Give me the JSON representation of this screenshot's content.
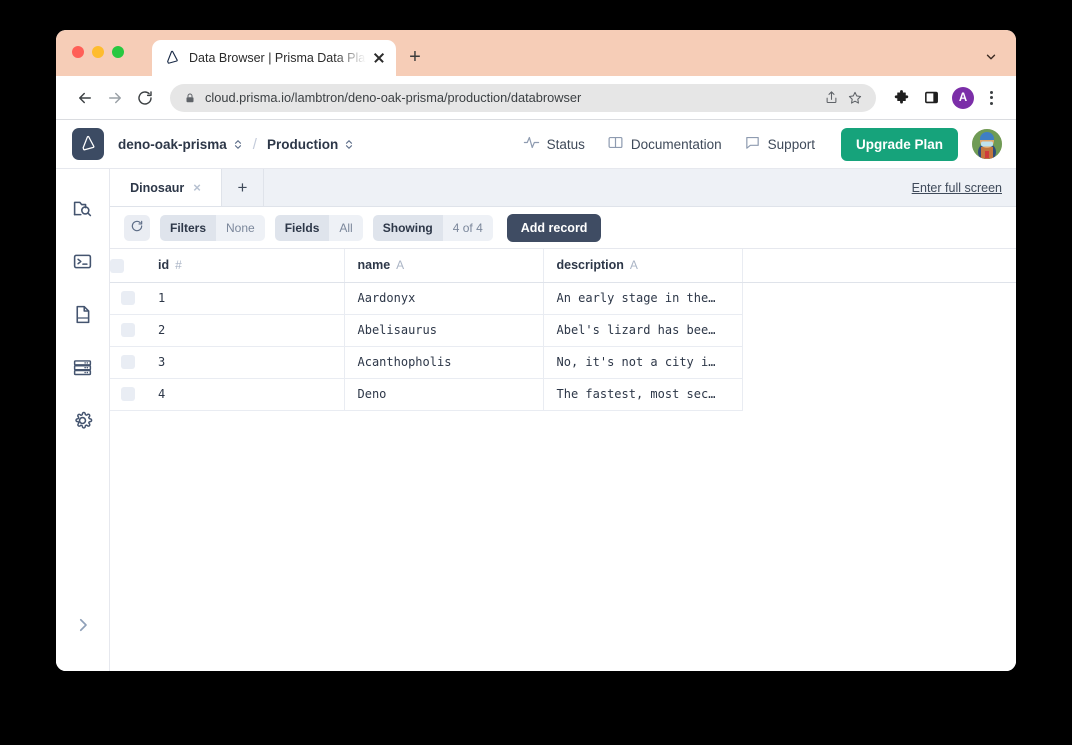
{
  "browser": {
    "tab": {
      "title": "Data Browser | Prisma Data Pla",
      "favicon": "prisma-logo-icon",
      "close": "×",
      "new_tab": "+"
    },
    "window_chevron": "chevron-down-icon",
    "nav": {
      "back": "back-arrow-icon",
      "forward": "forward-arrow-icon",
      "reload": "reload-icon"
    },
    "omnibox": {
      "url": "cloud.prisma.io/lambtron/deno-oak-prisma/production/databrowser",
      "lock": "lock-icon",
      "share": "share-icon",
      "bookmark": "star-icon"
    },
    "extensions_icon": "puzzle-piece-icon",
    "sidepanel_icon": "side-panel-icon",
    "profile_initial": "A",
    "menu_icon": "kebab-menu-icon"
  },
  "app_header": {
    "logo": "prisma-logo-icon",
    "project": "deno-oak-prisma",
    "separator": "/",
    "environment": "Production",
    "links": [
      {
        "label": "Status",
        "icon": "pulse-icon"
      },
      {
        "label": "Documentation",
        "icon": "book-icon"
      },
      {
        "label": "Support",
        "icon": "chat-icon"
      }
    ],
    "upgrade_label": "Upgrade Plan",
    "avatar": "user-avatar"
  },
  "sidebar": {
    "items": [
      {
        "name": "data-browser",
        "icon": "folder-search-icon"
      },
      {
        "name": "query-console",
        "icon": "terminal-icon"
      },
      {
        "name": "schema",
        "icon": "document-icon"
      },
      {
        "name": "database",
        "icon": "database-icon"
      },
      {
        "name": "settings",
        "icon": "gear-icon"
      }
    ],
    "expand_icon": "chevron-right-icon"
  },
  "model_tabs": {
    "tabs": [
      {
        "label": "Dinosaur",
        "close": "×",
        "active": true
      }
    ],
    "add_label": "+",
    "fullscreen_label": "Enter full screen"
  },
  "data_toolbar": {
    "refresh_icon": "refresh-icon",
    "controls": [
      {
        "key": "Filters",
        "value": "None"
      },
      {
        "key": "Fields",
        "value": "All"
      },
      {
        "key": "Showing",
        "value": "4 of 4"
      }
    ],
    "add_record_label": "Add record"
  },
  "table": {
    "columns": [
      {
        "label": "id",
        "type_mark": "#"
      },
      {
        "label": "name",
        "type_mark": "A"
      },
      {
        "label": "description",
        "type_mark": "A"
      }
    ],
    "rows": [
      {
        "id": "1",
        "name": "Aardonyx",
        "description": "An early stage in the…"
      },
      {
        "id": "2",
        "name": "Abelisaurus",
        "description": "Abel's lizard has bee…"
      },
      {
        "id": "3",
        "name": "Acanthopholis",
        "description": "No, it's not a city i…"
      },
      {
        "id": "4",
        "name": "Deno",
        "description": "The fastest, most sec…"
      }
    ]
  },
  "colors": {
    "titlebar": "#f6cdb7",
    "accent_green": "#16a37b",
    "brand_dark": "#3c4b63",
    "profile_purple": "#7b2ea8"
  }
}
